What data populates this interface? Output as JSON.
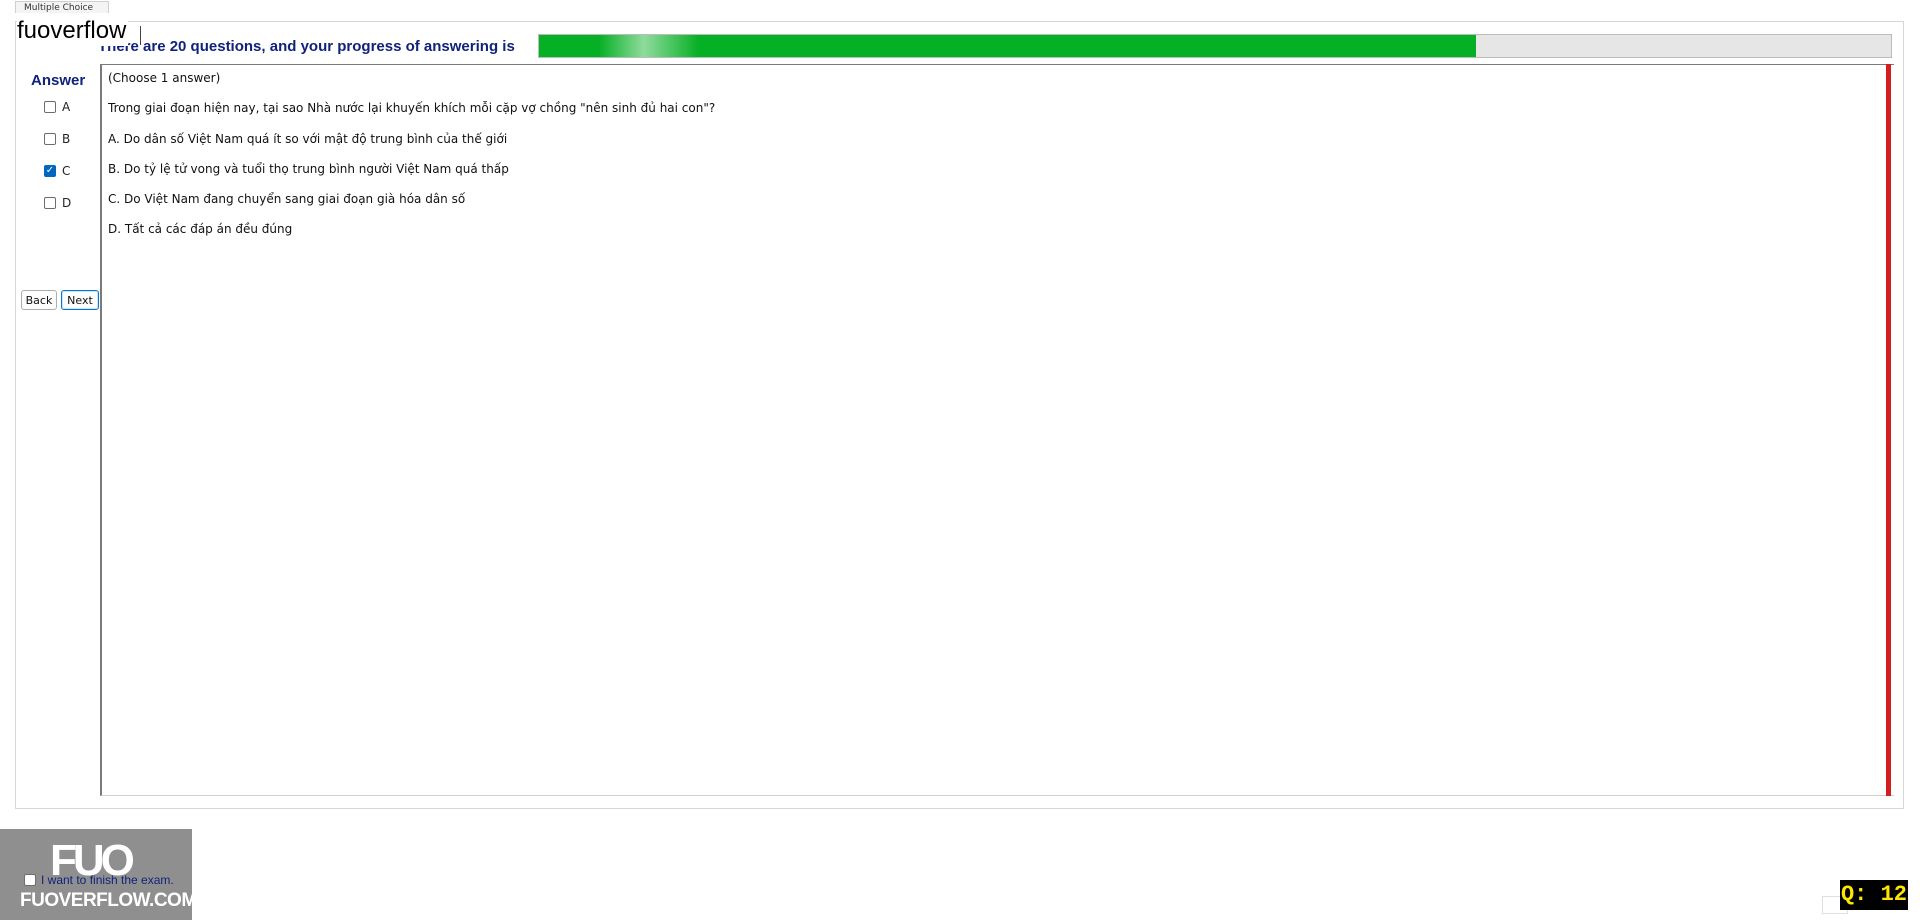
{
  "group": {
    "tab_label": "Multiple Choice"
  },
  "watermark": {
    "text": "fuoverflow"
  },
  "progress": {
    "label": "There are 20 questions, and your progress of answering is",
    "fraction": 0.693
  },
  "answer_panel": {
    "title": "Answer",
    "options": [
      {
        "letter": "A",
        "checked": false
      },
      {
        "letter": "B",
        "checked": false
      },
      {
        "letter": "C",
        "checked": true
      },
      {
        "letter": "D",
        "checked": false
      }
    ]
  },
  "nav": {
    "back_label": "Back",
    "next_label": "Next"
  },
  "question": {
    "instruction": "(Choose 1 answer)",
    "text": "Trong giai đoạn hiện nay, tại sao Nhà nước lại khuyến khích mỗi cặp vợ chồng \"nên sinh đủ hai con\"?",
    "choices": [
      "A.  Do dân số Việt Nam quá ít so với mật độ trung bình của thế giới",
      "B.  Do tỷ lệ tử vong và tuổi thọ trung bình người Việt Nam quá thấp",
      "C.  Do Việt Nam đang chuyển sang giai đoạn già hóa dân số",
      "D.  Tất cả các đáp án đều đúng"
    ]
  },
  "finish": {
    "label": "I want to finish the exam."
  },
  "logo": {
    "mark": "FUO",
    "site": "FUOVERFLOW.COM"
  },
  "badge": {
    "text": "Q: 12"
  },
  "colors": {
    "accent_green": "#06b025",
    "label_navy": "#10237a",
    "alert_red": "#d11f1f",
    "badge_yellow": "#ffe600"
  }
}
